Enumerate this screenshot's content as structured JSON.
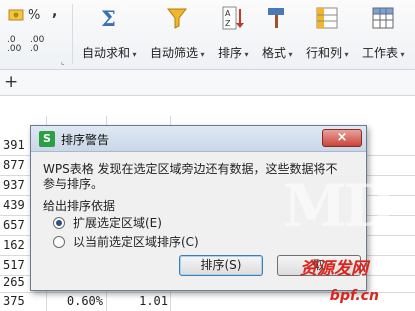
{
  "ribbon": {
    "percent": "%",
    "comma": ",",
    "inc_decimal": ".0\n.00",
    "dec_decimal": ".00\n.0",
    "autosum_label": "自动求和",
    "autofilter_label": "自动筛选",
    "sort_label": "排序",
    "format_label": "格式",
    "rowcol_label": "行和列",
    "worksheet_label": "工作表"
  },
  "formula_bar": {
    "add_symbol": "+"
  },
  "sheet": {
    "rows": [
      {
        "a": "391",
        "b": "",
        "c": ""
      },
      {
        "a": "877",
        "b": "",
        "c": ""
      },
      {
        "a": "937",
        "b": "",
        "c": ""
      },
      {
        "a": "439",
        "b": "",
        "c": ""
      },
      {
        "a": "657",
        "b": "",
        "c": ""
      },
      {
        "a": "162",
        "b": "",
        "c": ""
      },
      {
        "a": "517",
        "b": "",
        "c": ""
      },
      {
        "a": "265",
        "b": "",
        "c": ""
      },
      {
        "a": "375",
        "b": "0.60%",
        "c": "1.01"
      }
    ]
  },
  "dialog": {
    "title": "排序警告",
    "app_icon_letter": "S",
    "close_symbol": "×",
    "message": "WPS表格 发现在选定区域旁边还有数据，这些数据将不参与排序。",
    "group_label": "给出排序依据",
    "option_expand": "扩展选定区域(E)",
    "option_current": "以当前选定区域排序(C)",
    "sort_button": "排序(S)",
    "cancel_button": "取",
    "selected_option": "expand"
  },
  "watermark": {
    "logo_text": "MD",
    "site_text": "资源发网",
    "url_text": "ɓpf.cn"
  }
}
